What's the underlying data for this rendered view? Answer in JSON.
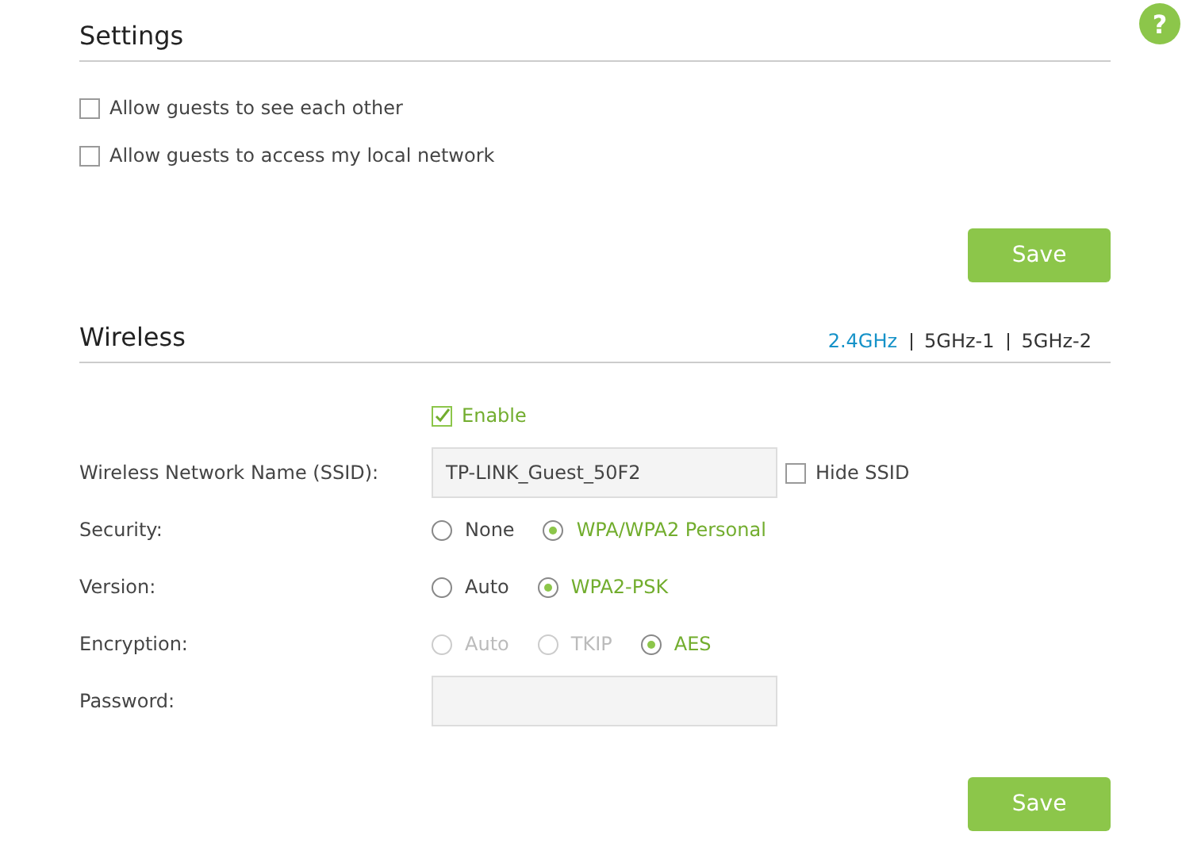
{
  "help_button": {
    "label": "?"
  },
  "settings": {
    "title": "Settings",
    "options": [
      {
        "label": "Allow guests to see each other",
        "checked": false
      },
      {
        "label": "Allow guests to access my local network",
        "checked": false
      }
    ],
    "save_button": "Save"
  },
  "wireless": {
    "title": "Wireless",
    "bands": [
      {
        "label": "2.4GHz",
        "selected": true
      },
      {
        "label": "5GHz-1",
        "selected": false
      },
      {
        "label": "5GHz-2",
        "selected": false
      }
    ],
    "enable": {
      "label": "Enable",
      "checked": true
    },
    "fields": [
      {
        "kind": "text",
        "label": "Wireless Network Name (SSID):",
        "value": "TP-LINK_Guest_50F2",
        "extra": {
          "label": "Hide SSID",
          "checked": false
        }
      },
      {
        "kind": "radio",
        "label": "Security:",
        "options": [
          {
            "label": "None",
            "selected": false,
            "disabled": false
          },
          {
            "label": "WPA/WPA2 Personal",
            "selected": true,
            "disabled": false
          }
        ]
      },
      {
        "kind": "radio",
        "label": "Version:",
        "options": [
          {
            "label": "Auto",
            "selected": false,
            "disabled": false
          },
          {
            "label": "WPA2-PSK",
            "selected": true,
            "disabled": false
          }
        ]
      },
      {
        "kind": "radio",
        "label": "Encryption:",
        "options": [
          {
            "label": "Auto",
            "selected": false,
            "disabled": true
          },
          {
            "label": "TKIP",
            "selected": false,
            "disabled": true
          },
          {
            "label": "AES",
            "selected": true,
            "disabled": false
          }
        ]
      },
      {
        "kind": "text",
        "label": "Password:"
      }
    ],
    "save_button": "Save"
  }
}
